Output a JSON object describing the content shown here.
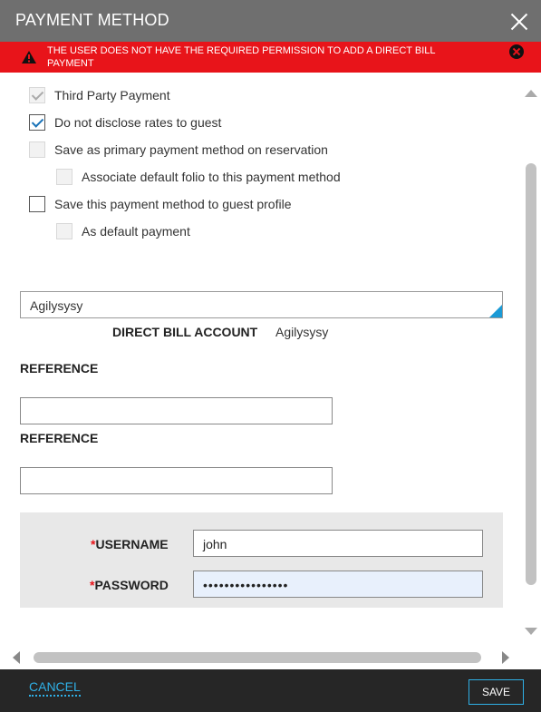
{
  "dialog": {
    "title": "PAYMENT METHOD"
  },
  "alert": {
    "message": "THE USER DOES NOT HAVE THE REQUIRED PERMISSION TO ADD A DIRECT BILL PAYMENT",
    "color": "#e8141a"
  },
  "options": {
    "third_party": {
      "label": "Third Party Payment",
      "checked": true,
      "disabled": true
    },
    "no_disclose": {
      "label": "Do not disclose rates to guest",
      "checked": true,
      "disabled": false
    },
    "primary": {
      "label": "Save as primary payment method on reservation",
      "checked": false,
      "disabled": true
    },
    "associate": {
      "label": "Associate default folio to this payment method",
      "checked": false,
      "disabled": true
    },
    "save_profile": {
      "label": "Save this payment method to guest profile",
      "checked": false,
      "disabled": false
    },
    "as_default": {
      "label": "As default payment",
      "checked": false,
      "disabled": true
    }
  },
  "account": {
    "combo_value": "Agilysysy",
    "direct_bill_label": "DIRECT BILL ACCOUNT",
    "direct_bill_value": "Agilysysy"
  },
  "references": [
    {
      "label": "REFERENCE",
      "value": ""
    },
    {
      "label": "REFERENCE",
      "value": ""
    }
  ],
  "credentials": {
    "required_mark": "*",
    "username_label": "USERNAME",
    "username_value": "john",
    "password_label": "PASSWORD",
    "password_mask": "••••••••••••••••"
  },
  "footer": {
    "cancel_label": "CANCEL",
    "save_label": "SAVE"
  },
  "colors": {
    "header": "#6f6f6f",
    "accent": "#2fb0e6",
    "footer": "#262626"
  }
}
